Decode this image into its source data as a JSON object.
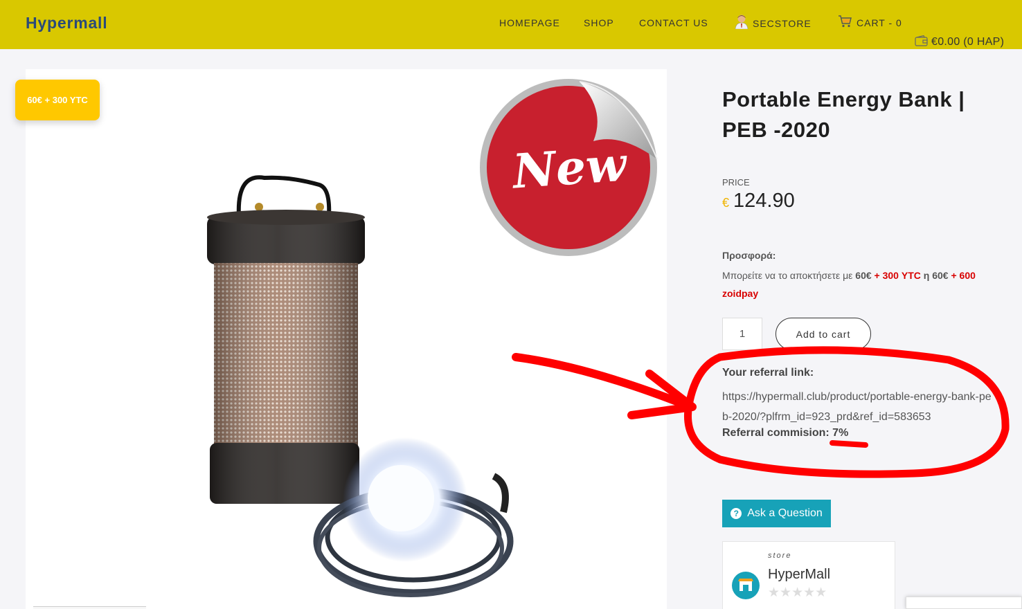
{
  "header": {
    "logo": "Hypermall",
    "nav": [
      {
        "label": "HOMEPAGE"
      },
      {
        "label": "SHOP"
      },
      {
        "label": "CONTACT US"
      },
      {
        "label": "SECSTORE",
        "icon": "user-avatar-icon"
      },
      {
        "label": "CART - 0",
        "icon": "cart-icon"
      }
    ],
    "wallet": "€0.00 (0 HAP)",
    "wallet_icon": "wallet-icon"
  },
  "product": {
    "badge": "60€ + 300 YTC",
    "sticker": "New",
    "title": "Portable Energy Bank | PEB -2020",
    "price_label": "PRICE",
    "currency": "€",
    "price": "124.90",
    "offer_label": "Προσφορά:",
    "offer": {
      "prefix": "Μπορείτε να το αποκτήσετε με",
      "amount1": "60€",
      "plus1": "+",
      "ytc": "300 YTC",
      "or": "η",
      "amount2": "60€",
      "plus2": "+",
      "zoid": "600 zoidpay"
    },
    "quantity": "1",
    "add_to_cart": "Add to cart",
    "referral_label": "Your referral link:",
    "referral_link": "https://hypermall.club/product/portable-energy-bank-peb-2020/?plfrm_id=923_prd&ref_id=583653",
    "referral_commission_label": "Referral commision:",
    "referral_commission": "7%",
    "ask_question": "Ask a Question"
  },
  "store": {
    "kicker": "store",
    "name": "HyperMall",
    "rating": 0,
    "stars": "★★★★★"
  },
  "colors": {
    "header": "#d9c800",
    "badge": "#ffc800",
    "sticker_red": "#c8202e",
    "accent_teal": "#17a2b8",
    "highlight_red": "#d80000",
    "annotation": "#ff0000"
  }
}
